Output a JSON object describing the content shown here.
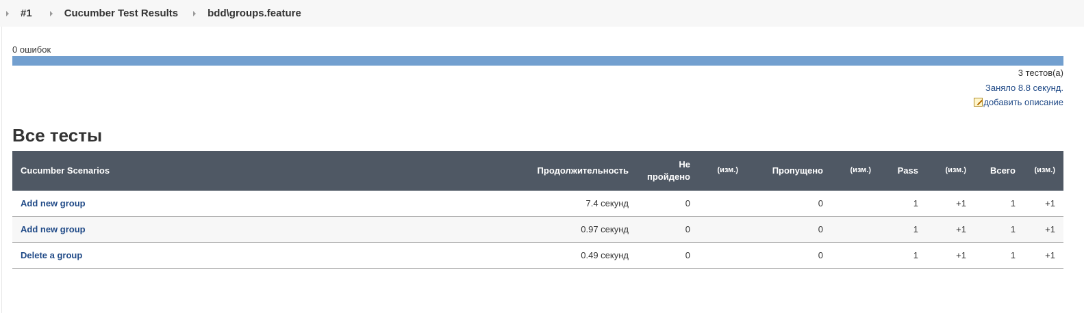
{
  "breadcrumbs": [
    "#1",
    "Cucumber Test Results",
    "bdd\\groups.feature"
  ],
  "summary": {
    "failures": "0 ошибок",
    "tests": "3 тестов(a)",
    "took": "Заняло 8.8 секунд.",
    "add_description": "добавить описание"
  },
  "progress": {
    "passed_fraction": 1.0,
    "color": "#729fcf"
  },
  "section_title": "Все тесты",
  "table": {
    "headers": {
      "name": "Cucumber Scenarios",
      "duration": "Продолжительность",
      "failed": "Не пройдено",
      "failed_diff": "(изм.)",
      "skipped": "Пропущено",
      "skipped_diff": "(изм.)",
      "pass": "Pass",
      "pass_diff": "(изм.)",
      "total": "Всего",
      "total_diff": "(изм.)"
    },
    "rows": [
      {
        "name": "Add new group",
        "duration": "7.4 секунд",
        "failed": "0",
        "failed_diff": "",
        "skipped": "0",
        "skipped_diff": "",
        "pass": "1",
        "pass_diff": "+1",
        "total": "1",
        "total_diff": "+1"
      },
      {
        "name": "Add new group",
        "duration": "0.97 секунд",
        "failed": "0",
        "failed_diff": "",
        "skipped": "0",
        "skipped_diff": "",
        "pass": "1",
        "pass_diff": "+1",
        "total": "1",
        "total_diff": "+1"
      },
      {
        "name": "Delete a group",
        "duration": "0.49 секунд",
        "failed": "0",
        "failed_diff": "",
        "skipped": "0",
        "skipped_diff": "",
        "pass": "1",
        "pass_diff": "+1",
        "total": "1",
        "total_diff": "+1"
      }
    ]
  },
  "colors": {
    "header_bg": "#4f5864",
    "link": "#204a87"
  }
}
